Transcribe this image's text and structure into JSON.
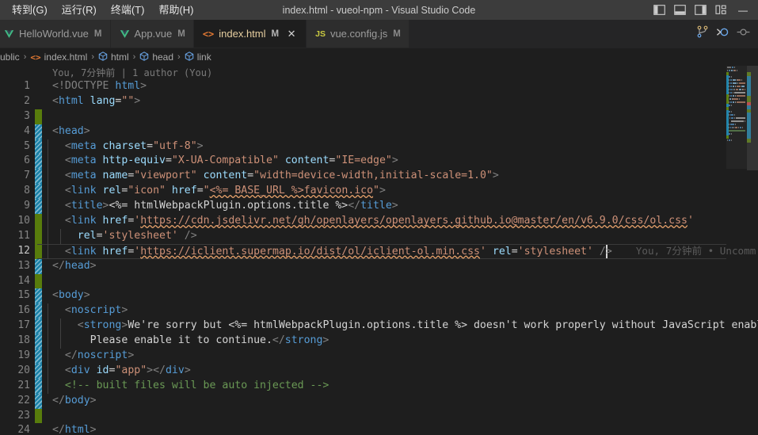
{
  "titlebar": {
    "menu": [
      {
        "label": "转到(G)",
        "name": "menu-goto"
      },
      {
        "label": "运行(R)",
        "name": "menu-run"
      },
      {
        "label": "终端(T)",
        "name": "menu-terminal"
      },
      {
        "label": "帮助(H)",
        "name": "menu-help"
      }
    ],
    "window_title": "index.html - vueol-npm - Visual Studio Code",
    "layout_icons": [
      {
        "name": "toggle-primary-sidebar-icon",
        "title": "切换主侧栏"
      },
      {
        "name": "toggle-panel-icon",
        "title": "切换面板"
      },
      {
        "name": "toggle-secondary-sidebar-icon",
        "title": "切换辅助侧栏"
      },
      {
        "name": "customize-layout-icon",
        "title": "自定义布局"
      }
    ],
    "minimize_glyph": "—"
  },
  "tabs": [
    {
      "label": "HelloWorld.vue",
      "dirty": "M",
      "icon": "vue-icon",
      "active": false,
      "closable": false
    },
    {
      "label": "App.vue",
      "dirty": "M",
      "icon": "vue-icon",
      "active": false,
      "closable": false
    },
    {
      "label": "index.html",
      "dirty": "M",
      "icon": "html-icon",
      "active": true,
      "closable": true,
      "close_glyph": "✕"
    },
    {
      "label": "vue.config.js",
      "dirty": "M",
      "icon": "js-icon",
      "active": false,
      "closable": false
    }
  ],
  "tab_actions": [
    {
      "name": "split-editor-icon"
    },
    {
      "name": "run-debug-icon"
    },
    {
      "name": "more-actions-icon"
    }
  ],
  "breadcrumbs": {
    "items": [
      {
        "label": "ublic",
        "icon": "none"
      },
      {
        "label": "index.html",
        "icon": "html"
      },
      {
        "label": "html",
        "icon": "cube"
      },
      {
        "label": "head",
        "icon": "cube"
      },
      {
        "label": "link",
        "icon": "cube"
      }
    ],
    "separator": "›"
  },
  "blame_header": "You, 7分钟前 | 1 author (You)",
  "inline_blame": "You, 7分钟前 • Uncomm",
  "editor": {
    "active_line": 12,
    "cursor_line": 12,
    "lines": [
      {
        "n": 1,
        "git": "none",
        "indent": 0,
        "tokens": [
          {
            "t": "punct",
            "v": "<!DOCTYPE "
          },
          {
            "t": "tag",
            "v": "html"
          },
          {
            "t": "punct",
            "v": ">"
          }
        ]
      },
      {
        "n": 2,
        "git": "none",
        "indent": 0,
        "tokens": [
          {
            "t": "punct",
            "v": "<"
          },
          {
            "t": "tag",
            "v": "html "
          },
          {
            "t": "attr",
            "v": "lang"
          },
          {
            "t": "eq",
            "v": "="
          },
          {
            "t": "str",
            "v": "\"\""
          },
          {
            "t": "punct",
            "v": ">"
          }
        ]
      },
      {
        "n": 3,
        "git": "add",
        "indent": 0,
        "tokens": []
      },
      {
        "n": 4,
        "git": "mod",
        "indent": 0,
        "tokens": [
          {
            "t": "punct",
            "v": "<"
          },
          {
            "t": "tag",
            "v": "head"
          },
          {
            "t": "punct",
            "v": ">"
          }
        ]
      },
      {
        "n": 5,
        "git": "mod",
        "indent": 1,
        "tokens": [
          {
            "t": "text",
            "v": "  "
          },
          {
            "t": "punct",
            "v": "<"
          },
          {
            "t": "tag",
            "v": "meta "
          },
          {
            "t": "attr",
            "v": "charset"
          },
          {
            "t": "eq",
            "v": "="
          },
          {
            "t": "str",
            "v": "\"utf-8\""
          },
          {
            "t": "punct",
            "v": ">"
          }
        ]
      },
      {
        "n": 6,
        "git": "mod",
        "indent": 1,
        "tokens": [
          {
            "t": "text",
            "v": "  "
          },
          {
            "t": "punct",
            "v": "<"
          },
          {
            "t": "tag",
            "v": "meta "
          },
          {
            "t": "attr",
            "v": "http-equiv"
          },
          {
            "t": "eq",
            "v": "="
          },
          {
            "t": "str",
            "v": "\"X-UA-Compatible\""
          },
          {
            "t": "text",
            "v": " "
          },
          {
            "t": "attr",
            "v": "content"
          },
          {
            "t": "eq",
            "v": "="
          },
          {
            "t": "str",
            "v": "\"IE=edge\""
          },
          {
            "t": "punct",
            "v": ">"
          }
        ]
      },
      {
        "n": 7,
        "git": "mod",
        "indent": 1,
        "tokens": [
          {
            "t": "text",
            "v": "  "
          },
          {
            "t": "punct",
            "v": "<"
          },
          {
            "t": "tag",
            "v": "meta "
          },
          {
            "t": "attr",
            "v": "name"
          },
          {
            "t": "eq",
            "v": "="
          },
          {
            "t": "str",
            "v": "\"viewport\""
          },
          {
            "t": "text",
            "v": " "
          },
          {
            "t": "attr",
            "v": "content"
          },
          {
            "t": "eq",
            "v": "="
          },
          {
            "t": "str",
            "v": "\"width=device-width,initial-scale=1.0\""
          },
          {
            "t": "punct",
            "v": ">"
          }
        ]
      },
      {
        "n": 8,
        "git": "mod",
        "indent": 1,
        "tokens": [
          {
            "t": "text",
            "v": "  "
          },
          {
            "t": "punct",
            "v": "<"
          },
          {
            "t": "tag",
            "v": "link "
          },
          {
            "t": "attr",
            "v": "rel"
          },
          {
            "t": "eq",
            "v": "="
          },
          {
            "t": "str",
            "v": "\"icon\""
          },
          {
            "t": "text",
            "v": " "
          },
          {
            "t": "attr",
            "v": "href"
          },
          {
            "t": "eq",
            "v": "="
          },
          {
            "t": "str",
            "v": "\""
          },
          {
            "t": "str-err",
            "v": "<%= BASE_URL %>favicon.ico"
          },
          {
            "t": "str",
            "v": "\""
          },
          {
            "t": "punct",
            "v": ">"
          }
        ]
      },
      {
        "n": 9,
        "git": "mod",
        "indent": 1,
        "tokens": [
          {
            "t": "text",
            "v": "  "
          },
          {
            "t": "punct",
            "v": "<"
          },
          {
            "t": "tag",
            "v": "title"
          },
          {
            "t": "punct",
            "v": ">"
          },
          {
            "t": "text",
            "v": "<%= htmlWebpackPlugin.options.title %>"
          },
          {
            "t": "punct",
            "v": "</"
          },
          {
            "t": "tag",
            "v": "title"
          },
          {
            "t": "punct",
            "v": ">"
          }
        ]
      },
      {
        "n": 10,
        "git": "add",
        "indent": 1,
        "tokens": [
          {
            "t": "text",
            "v": "  "
          },
          {
            "t": "punct",
            "v": "<"
          },
          {
            "t": "tag",
            "v": "link "
          },
          {
            "t": "attr",
            "v": "href"
          },
          {
            "t": "eq",
            "v": "="
          },
          {
            "t": "str",
            "v": "'"
          },
          {
            "t": "str-err",
            "v": "https://cdn.jsdelivr.net/gh/openlayers/openlayers.github.io@master/en/v6.9.0/css/ol.css"
          },
          {
            "t": "str",
            "v": "'"
          }
        ]
      },
      {
        "n": 11,
        "git": "add",
        "indent": 2,
        "tokens": [
          {
            "t": "text",
            "v": "    "
          },
          {
            "t": "attr",
            "v": "rel"
          },
          {
            "t": "eq",
            "v": "="
          },
          {
            "t": "str",
            "v": "'stylesheet'"
          },
          {
            "t": "text",
            "v": " "
          },
          {
            "t": "punct",
            "v": "/>"
          }
        ]
      },
      {
        "n": 12,
        "git": "add",
        "indent": 1,
        "tokens": [
          {
            "t": "text",
            "v": "  "
          },
          {
            "t": "punct",
            "v": "<"
          },
          {
            "t": "tag",
            "v": "link "
          },
          {
            "t": "attr",
            "v": "href"
          },
          {
            "t": "eq",
            "v": "="
          },
          {
            "t": "str",
            "v": "'"
          },
          {
            "t": "str-err",
            "v": "https://iclient.supermap.io/dist/ol/iclient-ol.min.css"
          },
          {
            "t": "str",
            "v": "'"
          },
          {
            "t": "text",
            "v": " "
          },
          {
            "t": "attr",
            "v": "rel"
          },
          {
            "t": "eq",
            "v": "="
          },
          {
            "t": "str",
            "v": "'stylesheet'"
          },
          {
            "t": "text",
            "v": " "
          },
          {
            "t": "punct",
            "v": "/>"
          }
        ]
      },
      {
        "n": 13,
        "git": "mod",
        "indent": 0,
        "tokens": [
          {
            "t": "punct",
            "v": "</"
          },
          {
            "t": "tag",
            "v": "head"
          },
          {
            "t": "punct",
            "v": ">"
          }
        ]
      },
      {
        "n": 14,
        "git": "add",
        "indent": 0,
        "tokens": []
      },
      {
        "n": 15,
        "git": "mod",
        "indent": 0,
        "tokens": [
          {
            "t": "punct",
            "v": "<"
          },
          {
            "t": "tag",
            "v": "body"
          },
          {
            "t": "punct",
            "v": ">"
          }
        ]
      },
      {
        "n": 16,
        "git": "mod",
        "indent": 1,
        "tokens": [
          {
            "t": "text",
            "v": "  "
          },
          {
            "t": "punct",
            "v": "<"
          },
          {
            "t": "tag",
            "v": "noscript"
          },
          {
            "t": "punct",
            "v": ">"
          }
        ]
      },
      {
        "n": 17,
        "git": "mod",
        "indent": 2,
        "tokens": [
          {
            "t": "text",
            "v": "    "
          },
          {
            "t": "punct",
            "v": "<"
          },
          {
            "t": "tag",
            "v": "strong"
          },
          {
            "t": "punct",
            "v": ">"
          },
          {
            "t": "text",
            "v": "We're sorry but <%= htmlWebpackPlugin.options.title %> doesn't work properly without JavaScript enabled."
          }
        ]
      },
      {
        "n": 18,
        "git": "mod",
        "indent": 2,
        "tokens": [
          {
            "t": "text",
            "v": "      Please enable it to continue."
          },
          {
            "t": "punct",
            "v": "</"
          },
          {
            "t": "tag",
            "v": "strong"
          },
          {
            "t": "punct",
            "v": ">"
          }
        ]
      },
      {
        "n": 19,
        "git": "mod",
        "indent": 1,
        "tokens": [
          {
            "t": "text",
            "v": "  "
          },
          {
            "t": "punct",
            "v": "</"
          },
          {
            "t": "tag",
            "v": "noscript"
          },
          {
            "t": "punct",
            "v": ">"
          }
        ]
      },
      {
        "n": 20,
        "git": "mod",
        "indent": 1,
        "tokens": [
          {
            "t": "text",
            "v": "  "
          },
          {
            "t": "punct",
            "v": "<"
          },
          {
            "t": "tag",
            "v": "div "
          },
          {
            "t": "attr",
            "v": "id"
          },
          {
            "t": "eq",
            "v": "="
          },
          {
            "t": "str",
            "v": "\"app\""
          },
          {
            "t": "punct",
            "v": "></"
          },
          {
            "t": "tag",
            "v": "div"
          },
          {
            "t": "punct",
            "v": ">"
          }
        ]
      },
      {
        "n": 21,
        "git": "mod",
        "indent": 1,
        "tokens": [
          {
            "t": "text",
            "v": "  "
          },
          {
            "t": "comment",
            "v": "<!-- built files will be auto injected -->"
          }
        ]
      },
      {
        "n": 22,
        "git": "mod",
        "indent": 0,
        "tokens": [
          {
            "t": "punct",
            "v": "</"
          },
          {
            "t": "tag",
            "v": "body"
          },
          {
            "t": "punct",
            "v": ">"
          }
        ]
      },
      {
        "n": 23,
        "git": "add",
        "indent": 0,
        "tokens": []
      },
      {
        "n": 24,
        "git": "none",
        "indent": 0,
        "tokens": [
          {
            "t": "punct",
            "v": "</"
          },
          {
            "t": "tag",
            "v": "html"
          },
          {
            "t": "punct",
            "v": ">"
          }
        ]
      }
    ]
  },
  "colors": {
    "editor_bg": "#1e1e1e",
    "titlebar_bg": "#3c3c3c",
    "tabbar_bg": "#252526",
    "tab_active_bg": "#1e1e1e",
    "tab_active_fg": "#e7cfa0",
    "git_added": "#587c0c",
    "git_modified": "#1b81a8",
    "tag": "#569cd6",
    "attr": "#9cdcfe",
    "string": "#ce9178",
    "comment": "#6a9955",
    "linenumber": "#858585"
  }
}
